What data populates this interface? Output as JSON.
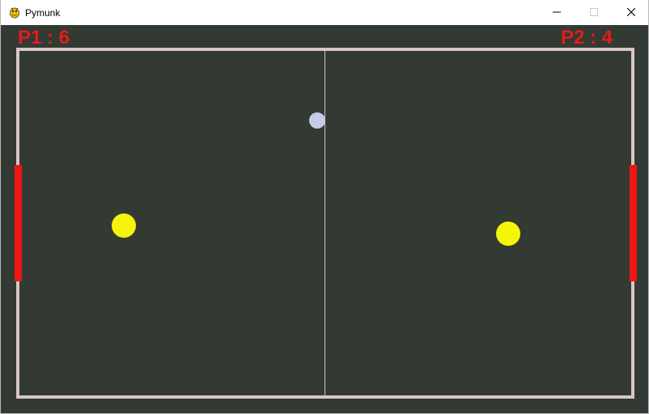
{
  "window": {
    "title": "Pymunk",
    "icon": "pygame-snake-icon"
  },
  "controls": {
    "minimize": "minimize-icon",
    "maximize": "maximize-icon",
    "close": "close-icon"
  },
  "scores": {
    "p1": "P1 : 6",
    "p2": "P2 : 4"
  },
  "colors": {
    "background": "#333a33",
    "walls": "#d8c7c3",
    "paddles": "#ef1616",
    "score_text": "#e31c1c",
    "puck": "#c4cbe6",
    "yellow_balls": "#f5f50b"
  }
}
